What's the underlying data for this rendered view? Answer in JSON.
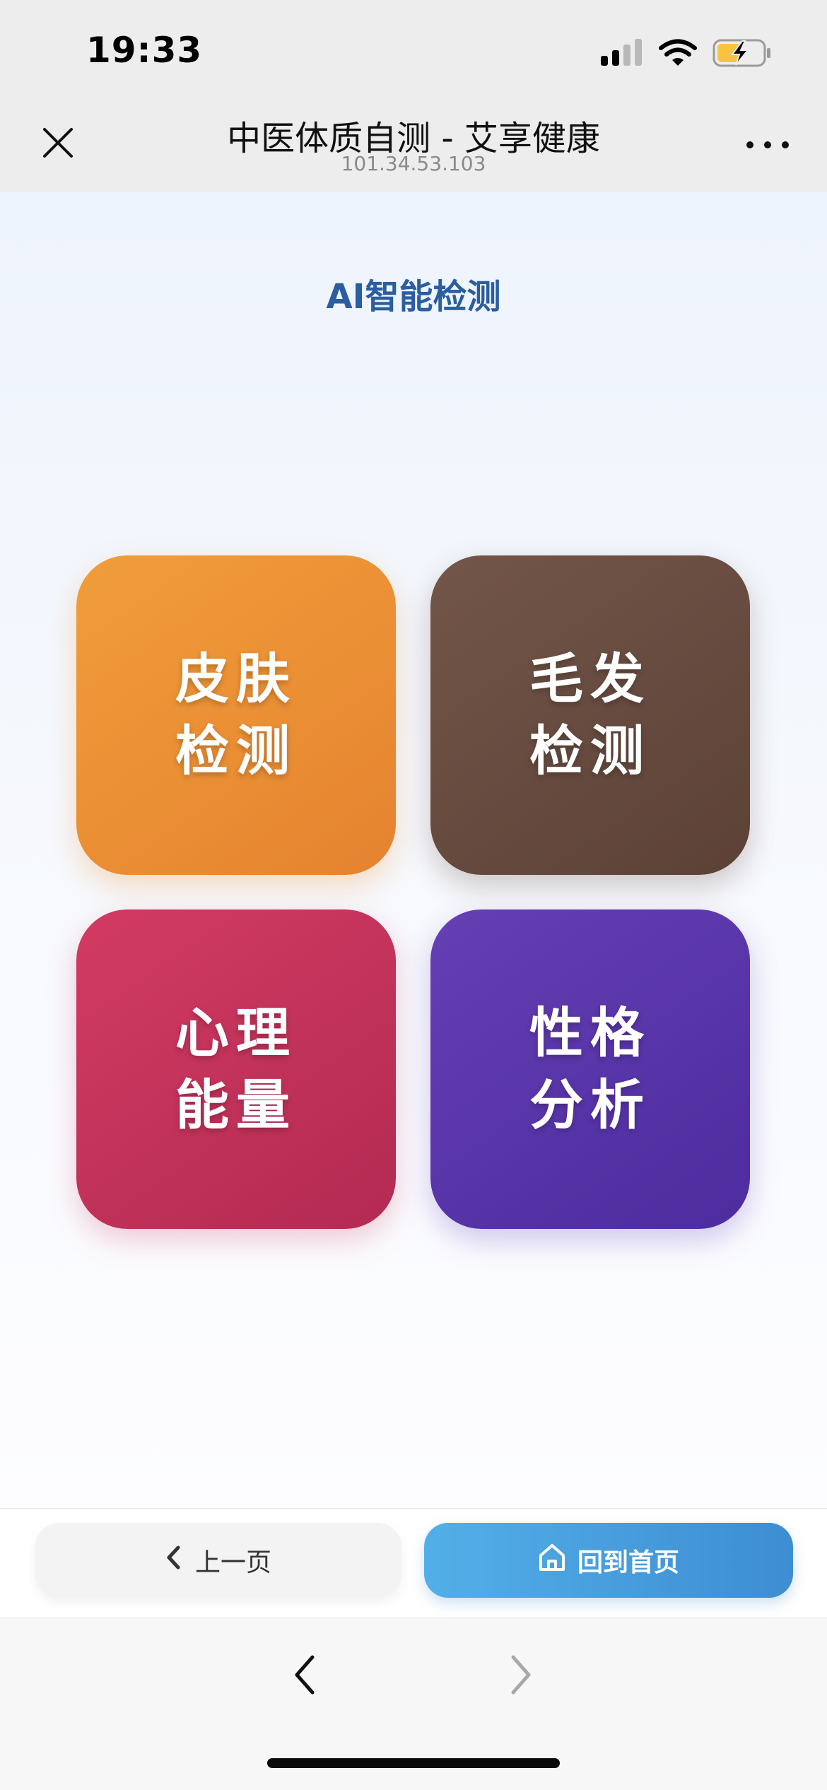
{
  "status_bar": {
    "time": "19:33",
    "icons": [
      "cellular-signal-icon",
      "wifi-icon",
      "battery-charging-icon"
    ],
    "battery_color": "#f5c542"
  },
  "nav": {
    "title": "中医体质自测 - 艾享健康",
    "subtitle": "101.34.53.103",
    "close_icon": "close-icon",
    "more_icon": "more-icon"
  },
  "page": {
    "heading": "AI智能检测",
    "heading_color": "#2a5ea0"
  },
  "tiles": [
    {
      "id": "skin",
      "line1": "皮肤",
      "line2": "检测",
      "color": "#ea8a33"
    },
    {
      "id": "hair",
      "line1": "毛发",
      "line2": "检测",
      "color": "#674b40"
    },
    {
      "id": "mind",
      "line1": "心理",
      "line2": "能量",
      "color": "#c9325b"
    },
    {
      "id": "personality",
      "line1": "性格",
      "line2": "分析",
      "color": "#5834a8"
    }
  ],
  "actions": {
    "prev_label": "上一页",
    "prev_icon": "chevron-left-icon",
    "home_label": "回到首页",
    "home_icon": "home-icon",
    "home_color": "#4a9fdf"
  },
  "browser": {
    "back_icon": "back-arrow-icon",
    "forward_icon": "forward-arrow-icon"
  }
}
